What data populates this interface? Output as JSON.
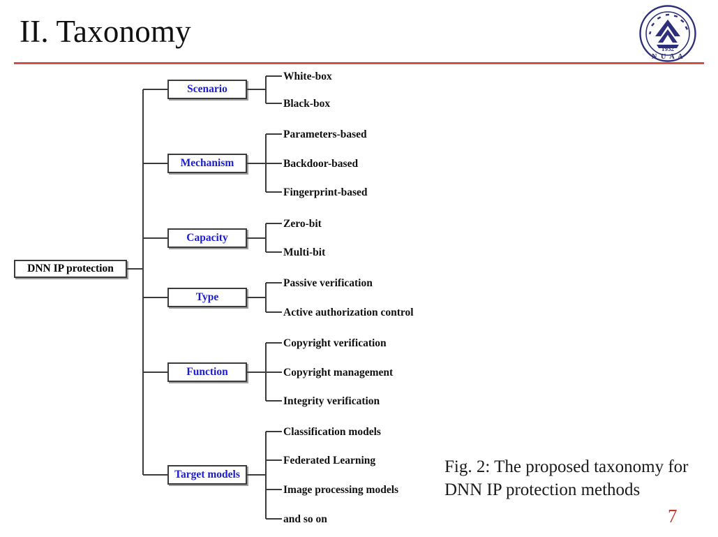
{
  "slide": {
    "title": "II. Taxonomy",
    "page_number": "7",
    "rule_color": "#d24f46",
    "page_number_color": "#c0392b",
    "category_text_color": "#1b1bd4",
    "leaf_text_color": "#111111"
  },
  "logo": {
    "name": "nuaa-university-logo",
    "year": "1952",
    "acronym": "N U A A",
    "ring_color": "#2d2f7a"
  },
  "diagram": {
    "root": {
      "label": "DNN IP protection"
    },
    "categories": [
      {
        "label": "Scenario",
        "leaves": [
          {
            "label": "White-box"
          },
          {
            "label": "Black-box"
          }
        ]
      },
      {
        "label": "Mechanism",
        "leaves": [
          {
            "label": "Parameters-based"
          },
          {
            "label": "Backdoor-based"
          },
          {
            "label": "Fingerprint-based"
          }
        ]
      },
      {
        "label": "Capacity",
        "leaves": [
          {
            "label": "Zero-bit"
          },
          {
            "label": "Multi-bit"
          }
        ]
      },
      {
        "label": "Type",
        "leaves": [
          {
            "label": "Passive verification"
          },
          {
            "label": "Active authorization control"
          }
        ]
      },
      {
        "label": "Function",
        "leaves": [
          {
            "label": "Copyright verification"
          },
          {
            "label": "Copyright management"
          },
          {
            "label": "Integrity verification"
          }
        ]
      },
      {
        "label": "Target models",
        "leaves": [
          {
            "label": "Classification models"
          },
          {
            "label": "Federated Learning"
          },
          {
            "label": "Image processing models"
          },
          {
            "label": "and so on"
          }
        ]
      }
    ]
  },
  "caption": {
    "text": "Fig. 2: The proposed taxonomy for DNN IP protection methods"
  }
}
